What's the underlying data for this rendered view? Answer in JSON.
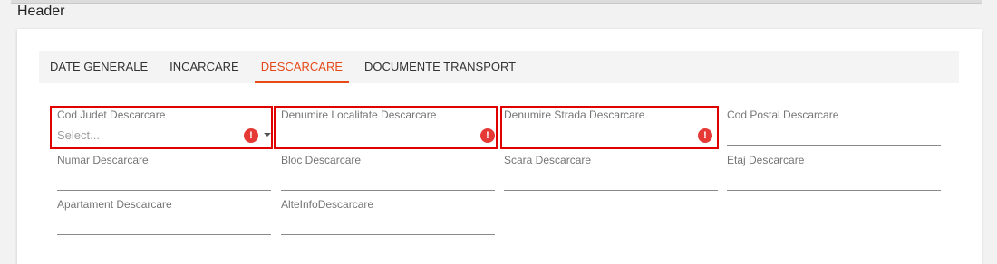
{
  "header": {
    "title": "Header"
  },
  "tabs": [
    {
      "label": "DATE GENERALE",
      "active": false
    },
    {
      "label": "INCARCARE",
      "active": false
    },
    {
      "label": "DESCARCARE",
      "active": true
    },
    {
      "label": "DOCUMENTE TRANSPORT",
      "active": false
    }
  ],
  "fields": {
    "cod_judet": {
      "label": "Cod Judet Descarcare",
      "placeholder": "Select...",
      "value": "",
      "error": true,
      "type": "select"
    },
    "denumire_localitate": {
      "label": "Denumire Localitate Descarcare",
      "value": "",
      "error": true
    },
    "denumire_strada": {
      "label": "Denumire Strada Descarcare",
      "value": "",
      "error": true
    },
    "cod_postal": {
      "label": "Cod Postal Descarcare",
      "value": "",
      "error": false
    },
    "numar": {
      "label": "Numar Descarcare",
      "value": "",
      "error": false
    },
    "bloc": {
      "label": "Bloc Descarcare",
      "value": "",
      "error": false
    },
    "scara": {
      "label": "Scara Descarcare",
      "value": "",
      "error": false
    },
    "etaj": {
      "label": "Etaj Descarcare",
      "value": "",
      "error": false
    },
    "apartament": {
      "label": "Apartament Descarcare",
      "value": "",
      "error": false
    },
    "alte_info": {
      "label": "AlteInfoDescarcare",
      "value": "",
      "error": false
    }
  },
  "colors": {
    "accent": "#e64a19",
    "error": "#e53935",
    "highlight_border": "#e00000"
  },
  "icons": {
    "error": "error-circle-icon",
    "dropdown": "caret-down-icon"
  }
}
